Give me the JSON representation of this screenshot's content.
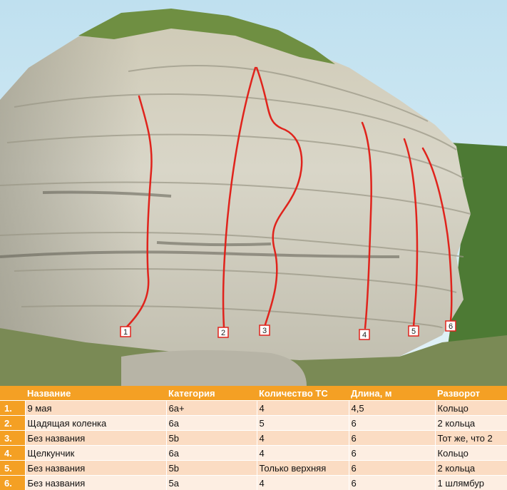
{
  "colors": {
    "header_bg": "#f4a024",
    "row_odd": "#fbdcc3",
    "row_even": "#fdeee2",
    "route_line": "#e0231c",
    "sky": "#cfe7f2"
  },
  "table": {
    "headers": [
      "",
      "Название",
      "Категория",
      "Количество ТС",
      "Длина, м",
      "Разворот"
    ],
    "rows": [
      {
        "num": "1.",
        "name": "9 мая",
        "grade": "6a+",
        "bolts": "4",
        "length": "4,5",
        "anchor": "Кольцо"
      },
      {
        "num": "2.",
        "name": "Щадящая коленка",
        "grade": "6a",
        "bolts": "5",
        "length": "6",
        "anchor": "2 кольца"
      },
      {
        "num": "3.",
        "name": "Без названия",
        "grade": "5b",
        "bolts": "4",
        "length": "6",
        "anchor": "Тот же, что 2"
      },
      {
        "num": "4.",
        "name": "Щелкунчик",
        "grade": "6a",
        "bolts": "4",
        "length": "6",
        "anchor": "Кольцо"
      },
      {
        "num": "5.",
        "name": "Без названия",
        "grade": "5b",
        "bolts": "Только верхняя",
        "length": "6",
        "anchor": "2 кольца"
      },
      {
        "num": "6.",
        "name": "Без названия",
        "grade": "5a",
        "bolts": "4",
        "length": "6",
        "anchor": "1 шлямбур"
      }
    ]
  },
  "markers": [
    "1",
    "2",
    "3",
    "4",
    "5",
    "6"
  ]
}
